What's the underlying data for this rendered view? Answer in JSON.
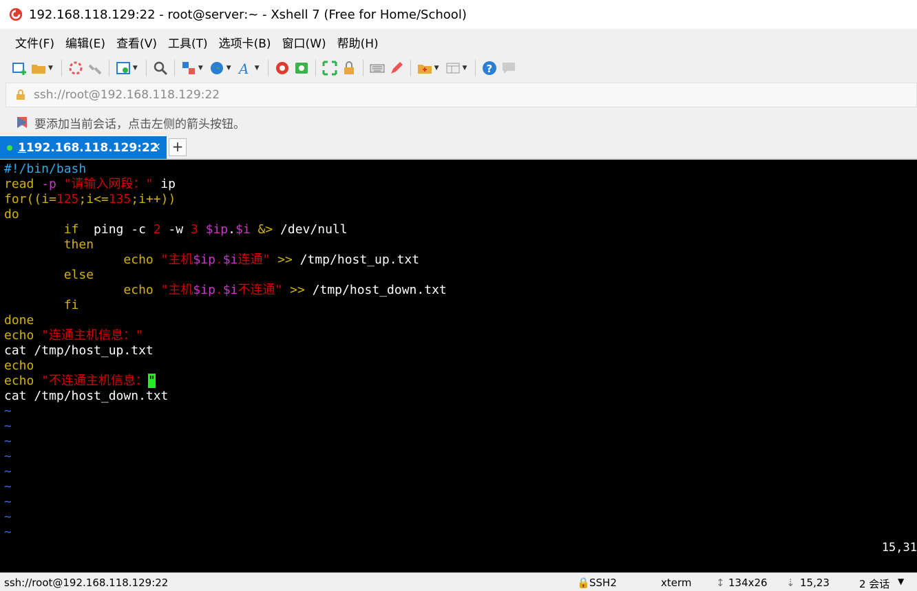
{
  "window": {
    "title": "192.168.118.129:22 - root@server:~ - Xshell 7 (Free for Home/School)"
  },
  "menu": [
    "文件(F)",
    "编辑(E)",
    "查看(V)",
    "工具(T)",
    "选项卡(B)",
    "窗口(W)",
    "帮助(H)"
  ],
  "address": {
    "value": "ssh://root@192.168.118.129:22"
  },
  "hint": {
    "text": "要添加当前会话，点击左侧的箭头按钮。"
  },
  "tab": {
    "number": "1",
    "label": " 192.168.118.129:22",
    "close": "×",
    "new": "+"
  },
  "terminal": {
    "lines": [
      [
        {
          "t": "#!/bin/bash",
          "c": "c-cy"
        }
      ],
      [
        {
          "t": "read ",
          "c": "c-yel"
        },
        {
          "t": "-p ",
          "c": "c-mag"
        },
        {
          "t": "\"请输入网段：\"",
          "c": "c-red"
        },
        {
          "t": " ip",
          "c": "c-wht"
        }
      ],
      [
        {
          "t": "for((",
          "c": "c-yel"
        },
        {
          "t": "i=",
          "c": "c-yel"
        },
        {
          "t": "125",
          "c": "c-red"
        },
        {
          "t": ";i<=",
          "c": "c-yel"
        },
        {
          "t": "135",
          "c": "c-red"
        },
        {
          "t": ";i++))",
          "c": "c-yel"
        }
      ],
      [
        {
          "t": "do",
          "c": "c-yel"
        }
      ],
      [
        {
          "t": "        if  ",
          "c": "c-yel"
        },
        {
          "t": "ping -c ",
          "c": "c-wht"
        },
        {
          "t": "2",
          "c": "c-red"
        },
        {
          "t": " -w ",
          "c": "c-wht"
        },
        {
          "t": "3",
          "c": "c-red"
        },
        {
          "t": " $ip",
          "c": "c-mag"
        },
        {
          "t": ".",
          "c": "c-wht"
        },
        {
          "t": "$i",
          "c": "c-mag"
        },
        {
          "t": " &> ",
          "c": "c-yel"
        },
        {
          "t": "/dev/null",
          "c": "c-wht"
        }
      ],
      [
        {
          "t": "        then",
          "c": "c-yel"
        }
      ],
      [
        {
          "t": "                echo ",
          "c": "c-yel"
        },
        {
          "t": "\"主机",
          "c": "c-red"
        },
        {
          "t": "$ip",
          "c": "c-mag"
        },
        {
          "t": ".",
          "c": "c-red"
        },
        {
          "t": "$i",
          "c": "c-mag"
        },
        {
          "t": "连通\"",
          "c": "c-red"
        },
        {
          "t": " >> ",
          "c": "c-yel"
        },
        {
          "t": "/tmp/host_up.txt",
          "c": "c-wht"
        }
      ],
      [
        {
          "t": "        else",
          "c": "c-yel"
        }
      ],
      [
        {
          "t": "                echo ",
          "c": "c-yel"
        },
        {
          "t": "\"主机",
          "c": "c-red"
        },
        {
          "t": "$ip",
          "c": "c-mag"
        },
        {
          "t": ".",
          "c": "c-red"
        },
        {
          "t": "$i",
          "c": "c-mag"
        },
        {
          "t": "不连通\"",
          "c": "c-red"
        },
        {
          "t": " >> ",
          "c": "c-yel"
        },
        {
          "t": "/tmp/host_down.txt",
          "c": "c-wht"
        }
      ],
      [
        {
          "t": "        fi",
          "c": "c-yel"
        }
      ],
      [
        {
          "t": "done",
          "c": "c-yel"
        }
      ],
      [
        {
          "t": "echo ",
          "c": "c-yel"
        },
        {
          "t": "\"连通主机信息：\"",
          "c": "c-red"
        }
      ],
      [
        {
          "t": "cat /tmp/host_up.txt",
          "c": "c-wht"
        }
      ],
      [
        {
          "t": "echo",
          "c": "c-yel"
        }
      ],
      [
        {
          "t": "echo ",
          "c": "c-yel"
        },
        {
          "t": "\"不连通主机信息：",
          "c": "c-red"
        },
        {
          "t": "\"",
          "c": "cursor"
        }
      ],
      [
        {
          "t": "cat /tmp/host_down.txt",
          "c": "c-wht"
        }
      ],
      [
        {
          "t": "~",
          "c": "tilde"
        }
      ],
      [
        {
          "t": "~",
          "c": "tilde"
        }
      ],
      [
        {
          "t": "~",
          "c": "tilde"
        }
      ],
      [
        {
          "t": "~",
          "c": "tilde"
        }
      ],
      [
        {
          "t": "~",
          "c": "tilde"
        }
      ],
      [
        {
          "t": "~",
          "c": "tilde"
        }
      ],
      [
        {
          "t": "~",
          "c": "tilde"
        }
      ],
      [
        {
          "t": "~",
          "c": "tilde"
        }
      ],
      [
        {
          "t": "~",
          "c": "tilde"
        }
      ]
    ],
    "cursor_pos": "15,31"
  },
  "status": {
    "conn": "ssh://root@192.168.118.129:22",
    "proto": "SSH2",
    "term": "xterm",
    "size": "134x26",
    "pos": "15,23",
    "sessions": "2 会话"
  }
}
